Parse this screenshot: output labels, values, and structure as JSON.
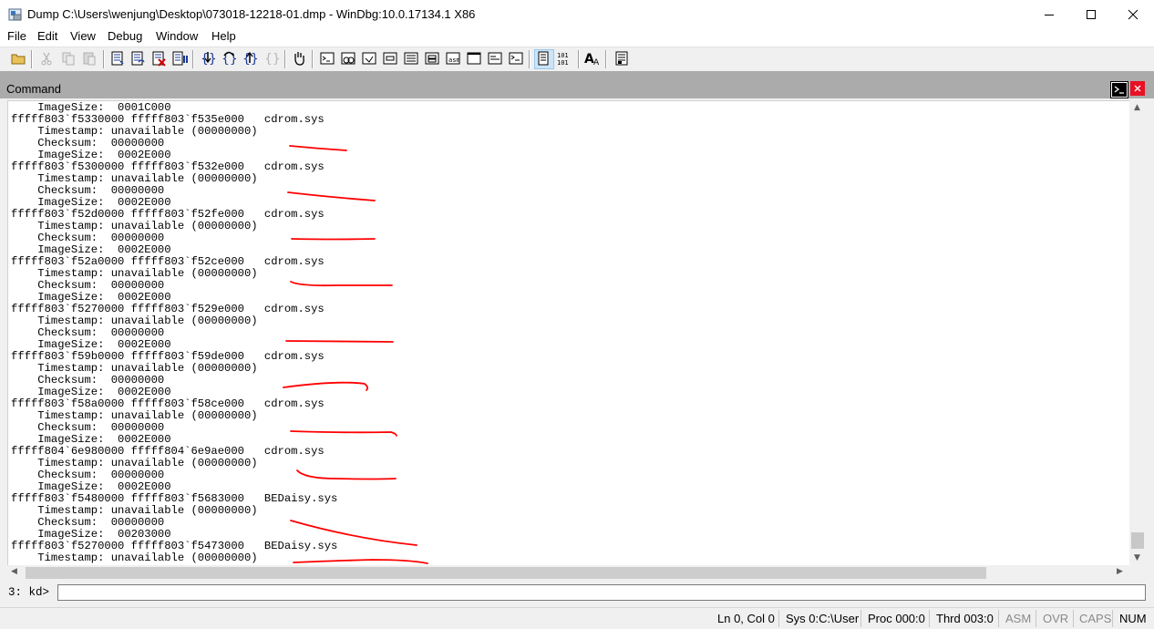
{
  "window": {
    "title": "Dump C:\\Users\\wenjung\\Desktop\\073018-12218-01.dmp - WinDbg:10.0.17134.1 X86",
    "app_icon": "windbg-app-icon",
    "controls": {
      "minimize": "minimize-icon",
      "maximize": "maximize-icon",
      "close": "close-icon"
    }
  },
  "menu": [
    "File",
    "Edit",
    "View",
    "Debug",
    "Window",
    "Help"
  ],
  "toolbar_icons": [
    "open-file-icon",
    "cut-icon",
    "copy-icon",
    "paste-icon",
    "step-into-source-icon",
    "step-over-source-icon",
    "stop-debugging-icon",
    "break-icon",
    "step-into-icon",
    "step-over-icon",
    "step-out-icon",
    "run-to-cursor-icon",
    "hand-icon",
    "command-window-icon",
    "watch-window-icon",
    "locals-window-icon",
    "registers-window-icon",
    "memory-window-icon",
    "call-stack-window-icon",
    "disassembly-window-icon",
    "scratch-pad-icon",
    "processes-threads-icon",
    "source-mode-icon",
    "hex-mode-icon",
    "font-icon",
    "options-icon"
  ],
  "command_window": {
    "title": "Command",
    "header_icons": {
      "console": "console-icon",
      "close": "close-icon"
    },
    "output_lines": [
      "    ImageSize:  0001C000",
      "fffff803`f5330000 fffff803`f535e000   cdrom.sys",
      "    Timestamp: unavailable (00000000)",
      "    Checksum:  00000000",
      "    ImageSize:  0002E000",
      "fffff803`f5300000 fffff803`f532e000   cdrom.sys",
      "    Timestamp: unavailable (00000000)",
      "    Checksum:  00000000",
      "    ImageSize:  0002E000",
      "fffff803`f52d0000 fffff803`f52fe000   cdrom.sys",
      "    Timestamp: unavailable (00000000)",
      "    Checksum:  00000000",
      "    ImageSize:  0002E000",
      "fffff803`f52a0000 fffff803`f52ce000   cdrom.sys",
      "    Timestamp: unavailable (00000000)",
      "    Checksum:  00000000",
      "    ImageSize:  0002E000",
      "fffff803`f5270000 fffff803`f529e000   cdrom.sys",
      "    Timestamp: unavailable (00000000)",
      "    Checksum:  00000000",
      "    ImageSize:  0002E000",
      "fffff803`f59b0000 fffff803`f59de000   cdrom.sys",
      "    Timestamp: unavailable (00000000)",
      "    Checksum:  00000000",
      "    ImageSize:  0002E000",
      "fffff803`f58a0000 fffff803`f58ce000   cdrom.sys",
      "    Timestamp: unavailable (00000000)",
      "    Checksum:  00000000",
      "    ImageSize:  0002E000",
      "fffff804`6e980000 fffff804`6e9ae000   cdrom.sys",
      "    Timestamp: unavailable (00000000)",
      "    Checksum:  00000000",
      "    ImageSize:  0002E000",
      "fffff803`f5480000 fffff803`f5683000   BEDaisy.sys",
      "    Timestamp: unavailable (00000000)",
      "    Checksum:  00000000",
      "    ImageSize:  00203000",
      "fffff803`f5270000 fffff803`f5473000   BEDaisy.sys",
      "    Timestamp: unavailable (00000000)"
    ],
    "annotation_color": "#ff0000",
    "prompt": "3: kd>",
    "input_value": ""
  },
  "status_bar": {
    "position": "Ln 0, Col 0",
    "sys": "Sys 0:C:\\User",
    "proc": "Proc 000:0",
    "thrd": "Thrd 003:0",
    "asm": "ASM",
    "ovr": "OVR",
    "caps": "CAPS",
    "num": "NUM"
  }
}
